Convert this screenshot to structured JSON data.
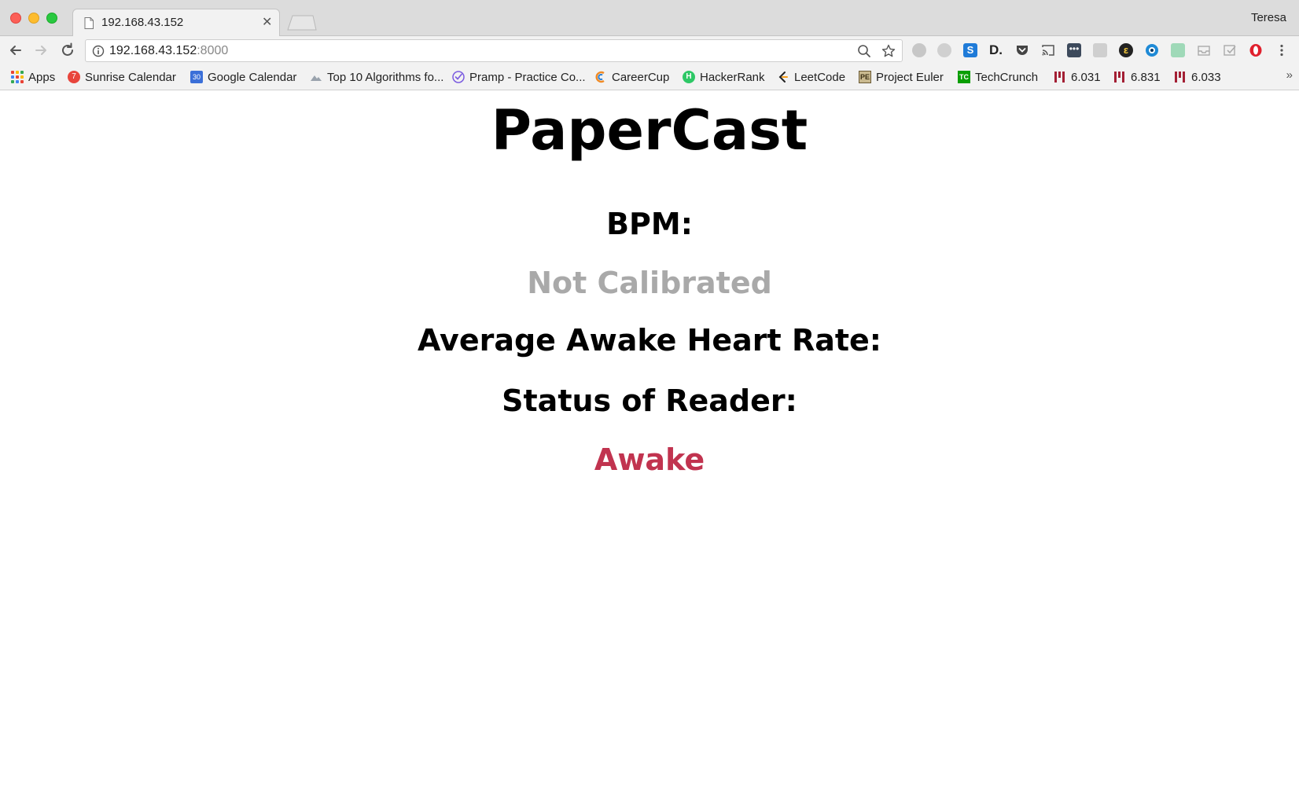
{
  "browser": {
    "tab_title": "192.168.43.152",
    "profile_name": "Teresa",
    "url_host": "192.168.43.152",
    "url_port": ":8000"
  },
  "bookmarks": [
    {
      "label": "Apps",
      "icon": "apps-grid-icon"
    },
    {
      "label": "Sunrise Calendar",
      "icon": "sunrise-calendar-icon"
    },
    {
      "label": "Google Calendar",
      "icon": "google-calendar-icon"
    },
    {
      "label": "Top 10 Algorithms fo...",
      "icon": "mountain-icon"
    },
    {
      "label": "Pramp - Practice Co...",
      "icon": "pramp-check-icon"
    },
    {
      "label": "CareerCup",
      "icon": "careercup-icon"
    },
    {
      "label": "HackerRank",
      "icon": "hackerrank-icon"
    },
    {
      "label": "LeetCode",
      "icon": "leetcode-icon"
    },
    {
      "label": "Project Euler",
      "icon": "project-euler-icon"
    },
    {
      "label": "TechCrunch",
      "icon": "techcrunch-icon"
    },
    {
      "label": "6.031",
      "icon": "mit-icon"
    },
    {
      "label": "6.831",
      "icon": "mit-icon"
    },
    {
      "label": "6.033",
      "icon": "mit-icon"
    }
  ],
  "page": {
    "title": "PaperCast",
    "bpm_label": "BPM:",
    "bpm_value": "Not Calibrated",
    "avg_label": "Average Awake Heart Rate:",
    "status_label": "Status of Reader:",
    "status_value": "Awake"
  },
  "colors": {
    "not_calibrated": "#a9a9a9",
    "awake": "#c1334f"
  }
}
